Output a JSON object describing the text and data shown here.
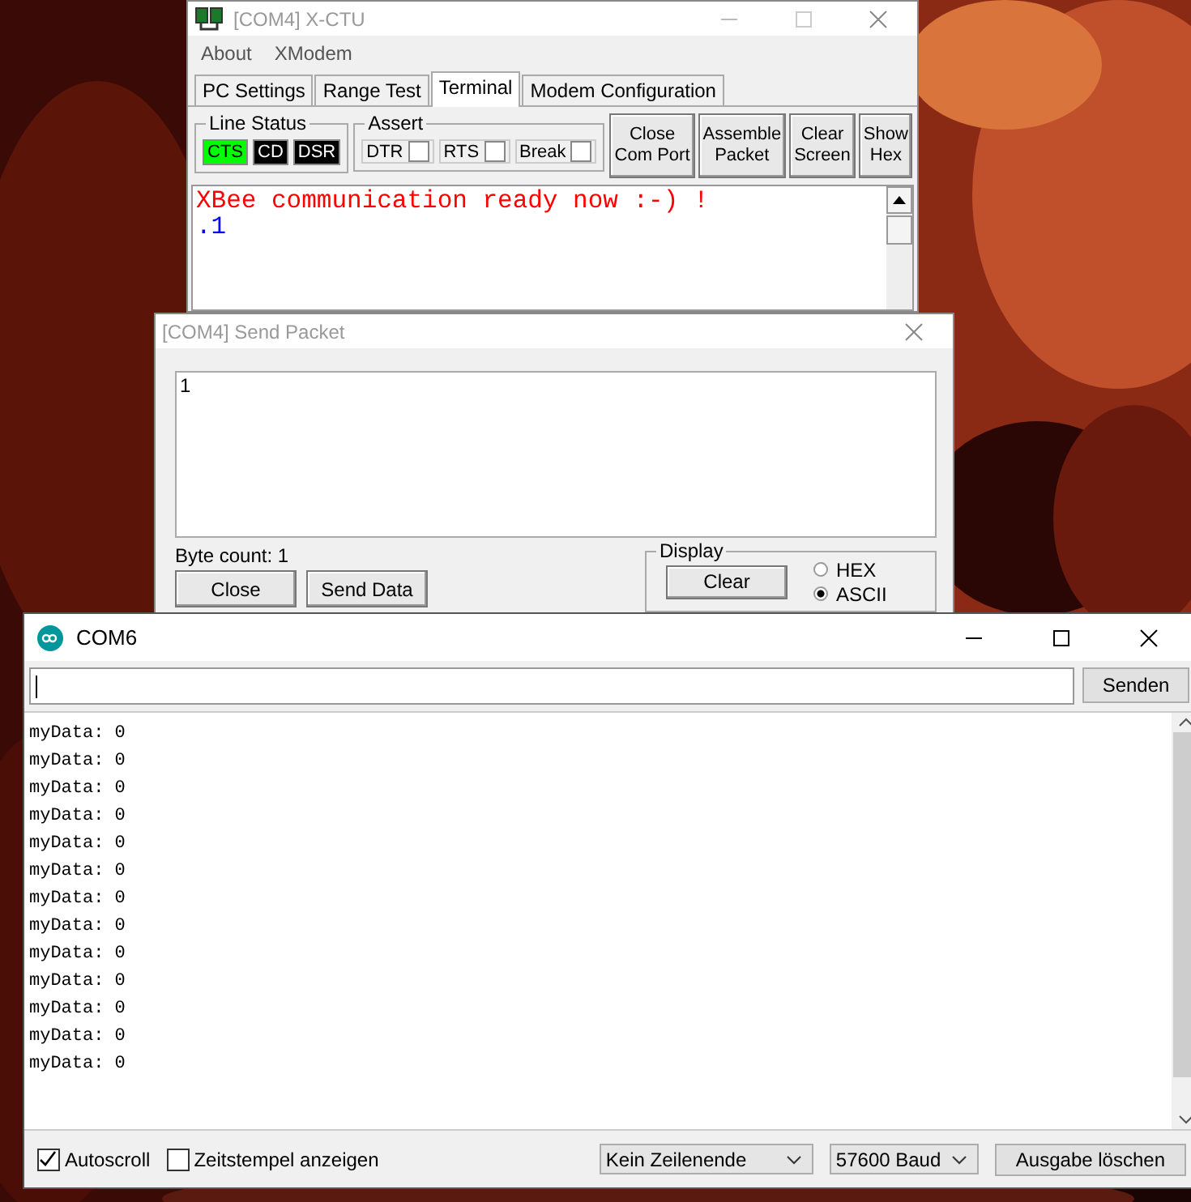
{
  "xctu": {
    "title": "[COM4] X-CTU",
    "menu": [
      "About",
      "XModem"
    ],
    "tabs": [
      {
        "label": "PC Settings",
        "selected": false
      },
      {
        "label": "Range Test",
        "selected": false
      },
      {
        "label": "Terminal",
        "selected": true
      },
      {
        "label": "Modem Configuration",
        "selected": false
      }
    ],
    "line_status": {
      "label": "Line Status",
      "indicators": [
        {
          "label": "CTS",
          "on": true
        },
        {
          "label": "CD",
          "on": false
        },
        {
          "label": "DSR",
          "on": false
        }
      ]
    },
    "assert": {
      "label": "Assert",
      "items": [
        {
          "label": "DTR",
          "checked": false
        },
        {
          "label": "RTS",
          "checked": false
        },
        {
          "label": "Break",
          "checked": false
        }
      ]
    },
    "buttons": [
      [
        "Close",
        "Com Port"
      ],
      [
        "Assemble",
        "Packet"
      ],
      [
        "Clear",
        "Screen"
      ],
      [
        "Show",
        "Hex"
      ]
    ],
    "terminal_lines": [
      {
        "text": "XBee communication ready now :-) !",
        "color": "#ff0000"
      },
      {
        "text": ".1",
        "color": "#0000ff"
      }
    ]
  },
  "send_packet": {
    "title": "[COM4] Send Packet",
    "text": "1",
    "byte_count": "Byte count: 1",
    "buttons": [
      "Close",
      "Send Data"
    ],
    "display": {
      "label": "Display",
      "clear_button": "Clear",
      "options": [
        {
          "label": "HEX",
          "selected": false
        },
        {
          "label": "ASCII",
          "selected": true
        }
      ]
    }
  },
  "serial_monitor": {
    "title": "COM6",
    "send_button": "Senden",
    "lines": [
      "myData: 0",
      "myData: 0",
      "myData: 0",
      "myData: 0",
      "myData: 0",
      "myData: 0",
      "myData: 0",
      "myData: 0",
      "myData: 0",
      "myData: 0",
      "myData: 0",
      "myData: 0",
      "myData: 0"
    ],
    "autoscroll": {
      "label": "Autoscroll",
      "checked": true
    },
    "timestamp": {
      "label": "Zeitstempel anzeigen",
      "checked": false
    },
    "line_ending": "Kein Zeilenende",
    "baud": "57600 Baud",
    "clear_button": "Ausgabe löschen"
  }
}
